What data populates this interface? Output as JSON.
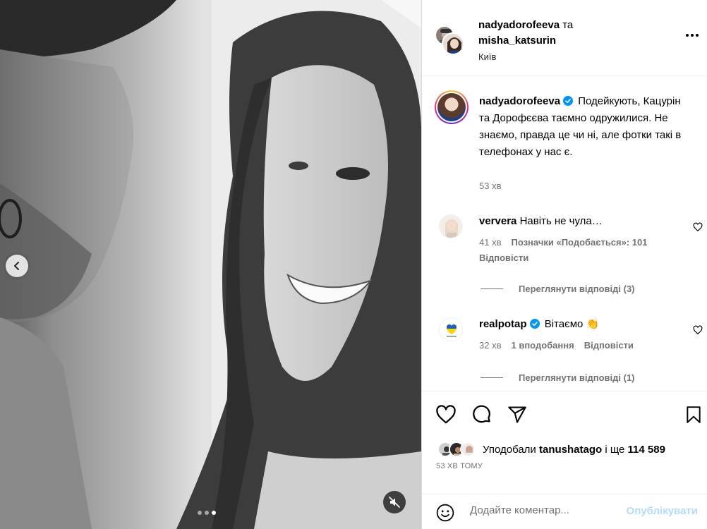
{
  "post": {
    "carousel": {
      "slide_count": 3,
      "active_slide": 3
    }
  },
  "header": {
    "author": "nadyadorofeeva",
    "conjunction": "та",
    "collaborator": "misha_katsurin",
    "location": "Київ",
    "more_icon": "more-horizontal-icon"
  },
  "caption": {
    "username": "nadyadorofeeva",
    "verified": true,
    "text": "Подейкують, Кацурін та Дорофєєва таємно одружилися. Не знаємо, правда це чи ні, але фотки такі в телефонах у нас є.",
    "time": "53 хв"
  },
  "comments": [
    {
      "username": "ververa",
      "verified": false,
      "text": "Навіть не чула…",
      "time": "41 хв",
      "likes": "Позначки «Подобається»: 101",
      "reply_label": "Відповісти",
      "view_replies": "Переглянути відповіді (3)"
    },
    {
      "username": "realpotap",
      "verified": true,
      "text": "Вітаємо 👏",
      "time": "32 хв",
      "likes": "1 вподобання",
      "reply_label": "Відповісти",
      "view_replies": "Переглянути відповіді (1)"
    }
  ],
  "actions": {
    "icons": [
      "heart-icon",
      "comment-icon",
      "share-icon",
      "bookmark-icon"
    ]
  },
  "likes": {
    "prefix": "Уподобали",
    "user": "tanushatago",
    "middle": "і ще",
    "count": "114 589"
  },
  "time_ago": "53 ХВ ТОМУ",
  "add_comment": {
    "placeholder": "Додайте коментар...",
    "post_label": "Опублікувати"
  },
  "colors": {
    "verified": "#0095f6",
    "post_disabled": "#b3dbff",
    "secondary_text": "#737373"
  }
}
